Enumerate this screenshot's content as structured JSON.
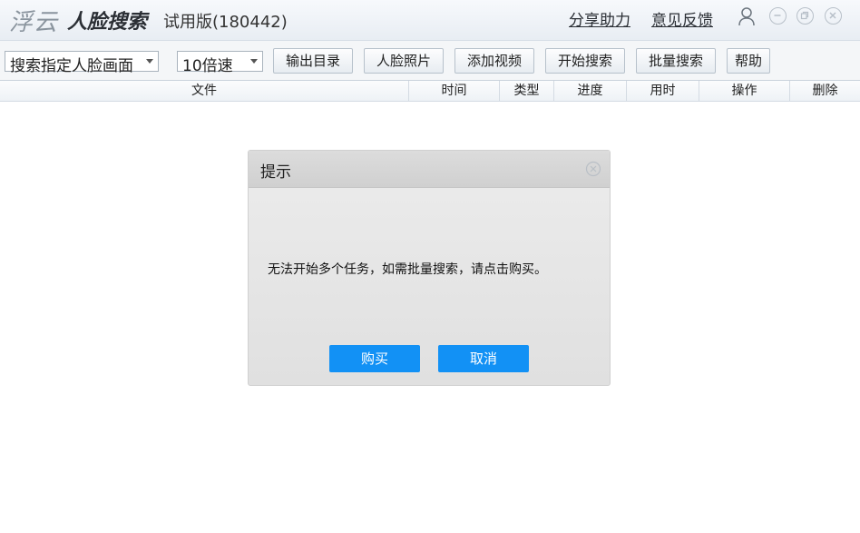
{
  "app": {
    "brand_fuyun": "浮云",
    "brand_name": "人脸搜索",
    "edition": "试用版(180442)",
    "links": {
      "share": "分享助力",
      "feedback": "意见反馈"
    }
  },
  "toolbar": {
    "mode_select": "搜索指定人脸画面",
    "speed_select": "10倍速",
    "output_dir": "输出目录",
    "face_photo": "人脸照片",
    "add_video": "添加视频",
    "start_search": "开始搜索",
    "batch_search": "批量搜索",
    "help": "帮助"
  },
  "table": {
    "columns": [
      "文件",
      "时间",
      "类型",
      "进度",
      "用时",
      "操作",
      "删除"
    ]
  },
  "dialog": {
    "title": "提示",
    "message": "无法开始多个任务，如需批量搜索，请点击购买。",
    "buy": "购买",
    "cancel": "取消"
  },
  "colors": {
    "primary_button": "#1291f5"
  }
}
